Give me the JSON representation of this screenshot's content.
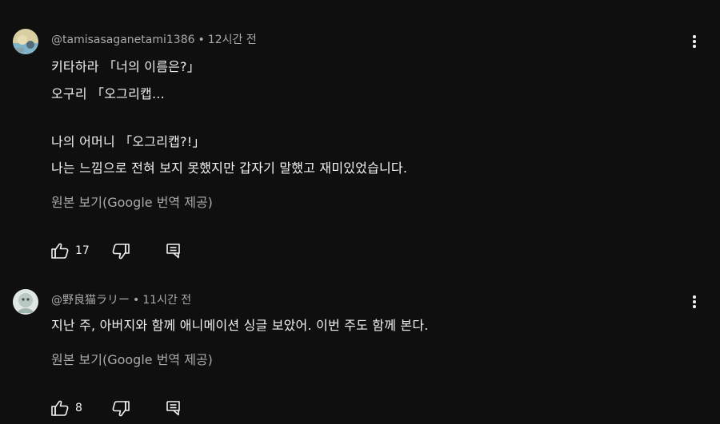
{
  "comments": [
    {
      "author": "@tamisasaganetami1386",
      "time": "12시간 전",
      "lines": [
        "키타하라 「너의 이름은?」",
        "오구리 「오그리캡…",
        "",
        "나의 어머니 「오그리캡?!」",
        "나는 느낌으로 전혀 보지 못했지만 갑자기 말했고 재미있었습니다."
      ],
      "translate_label": "원본 보기(Google 번역 제공)",
      "likes": "17"
    },
    {
      "author": "@野良猫ラリー",
      "time": "11시간 전",
      "lines": [
        "지난 주, 아버지와 함께 애니메이션 싱글  보았어. 이번 주도 함께 본다."
      ],
      "translate_label": "원본 보기(Google 번역 제공)",
      "likes": "8"
    }
  ],
  "separator": "•",
  "icons": {
    "like": "thumb-up-icon",
    "dislike": "thumb-down-icon",
    "reply": "reply-icon",
    "more": "more-vert-icon"
  },
  "colors": {
    "background": "#0f0f0f",
    "primary_text": "#f1f1f1",
    "secondary_text": "#aaaaaa"
  }
}
